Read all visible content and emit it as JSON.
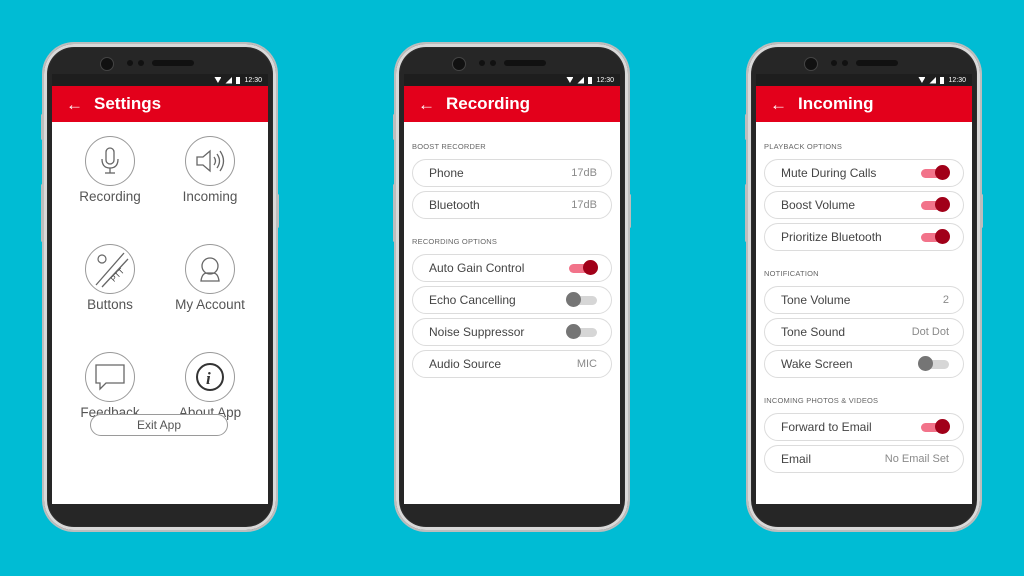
{
  "colors": {
    "background": "#00bcd4",
    "appbar": "#e3001b",
    "toggle_on_knob": "#a10019",
    "toggle_on_track": "#f2738a"
  },
  "status_time": "12:30",
  "settings_screen": {
    "title": "Settings",
    "tiles": [
      {
        "label": "Recording",
        "icon": "microphone-icon"
      },
      {
        "label": "Incoming",
        "icon": "speaker-icon"
      },
      {
        "label": "Buttons",
        "icon": "ptt-button-icon",
        "icon_text": "PTT"
      },
      {
        "label": "My Account",
        "icon": "account-icon"
      },
      {
        "label": "Feedback",
        "icon": "speech-bubble-icon"
      },
      {
        "label": "About App",
        "icon": "info-icon"
      }
    ],
    "exit_label": "Exit App"
  },
  "recording_screen": {
    "title": "Recording",
    "sections": [
      {
        "header": "BOOST RECORDER",
        "rows": [
          {
            "label": "Phone",
            "value": "17dB"
          },
          {
            "label": "Bluetooth",
            "value": "17dB"
          }
        ]
      },
      {
        "header": "RECORDING OPTIONS",
        "rows": [
          {
            "label": "Auto Gain Control",
            "toggle": true
          },
          {
            "label": "Echo Cancelling",
            "toggle": false
          },
          {
            "label": "Noise Suppressor",
            "toggle": false
          },
          {
            "label": "Audio Source",
            "value": "MIC"
          }
        ]
      }
    ]
  },
  "incoming_screen": {
    "title": "Incoming",
    "sections": [
      {
        "header": "PLAYBACK OPTIONS",
        "rows": [
          {
            "label": "Mute During Calls",
            "toggle": true
          },
          {
            "label": "Boost Volume",
            "toggle": true
          },
          {
            "label": "Prioritize Bluetooth",
            "toggle": true
          }
        ]
      },
      {
        "header": "NOTIFICATION",
        "rows": [
          {
            "label": "Tone Volume",
            "value": "2"
          },
          {
            "label": "Tone Sound",
            "value": "Dot Dot"
          },
          {
            "label": "Wake Screen",
            "toggle": false
          }
        ]
      },
      {
        "header": "INCOMING PHOTOS & VIDEOS",
        "rows": [
          {
            "label": "Forward to Email",
            "toggle": true
          },
          {
            "label": "Email",
            "value": "No Email Set"
          }
        ]
      }
    ]
  }
}
